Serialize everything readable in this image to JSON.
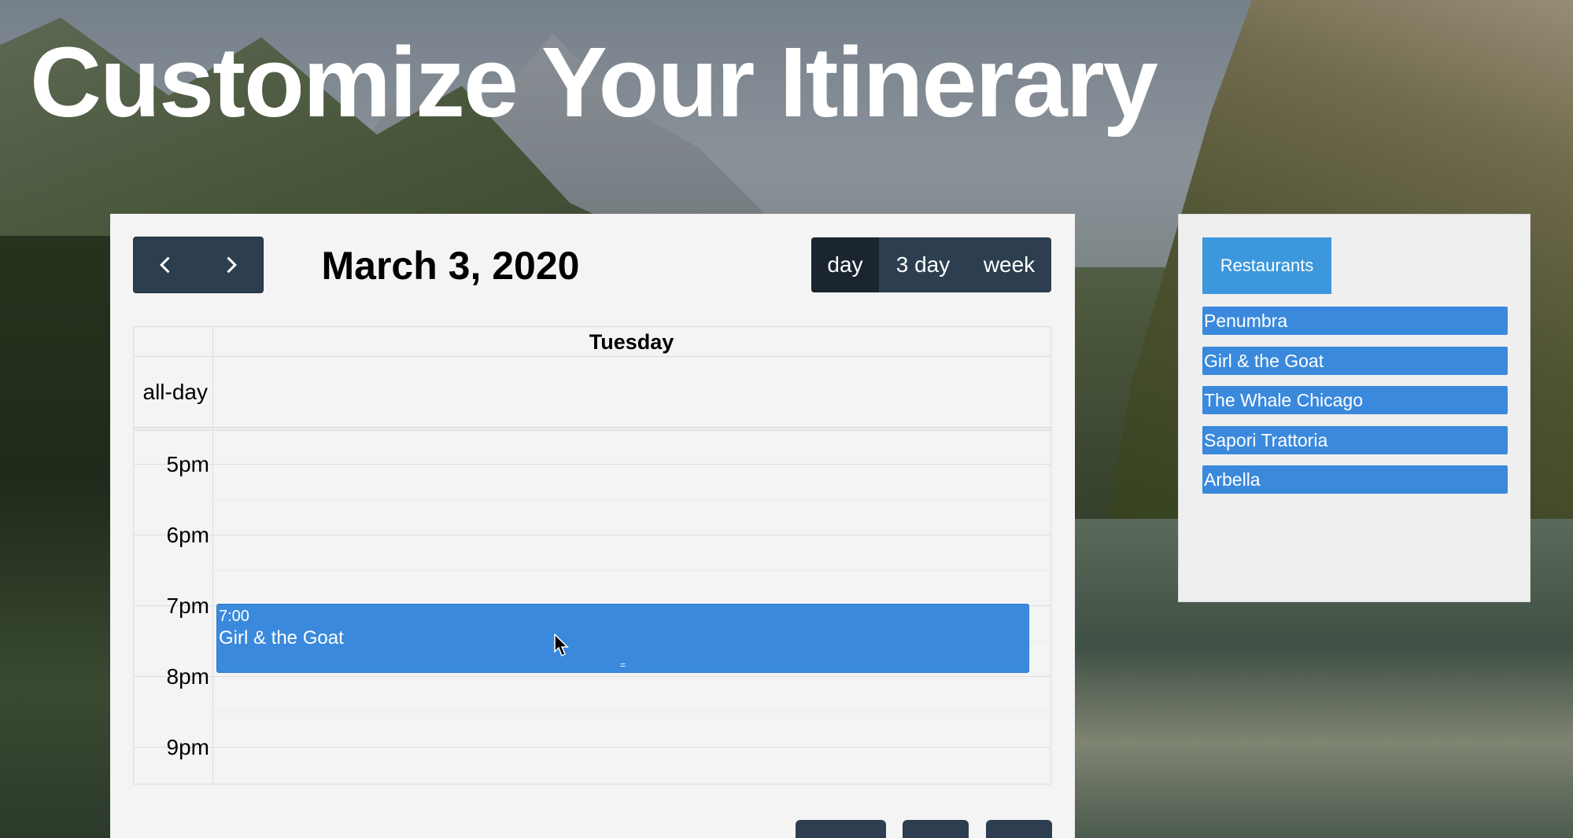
{
  "page": {
    "title": "Customize Your Itinerary"
  },
  "calendar": {
    "date_title": "March 3, 2020",
    "views": [
      "day",
      "3 day",
      "week"
    ],
    "active_view": "day",
    "day_header": "Tuesday",
    "allday_label": "all-day",
    "time_labels": [
      "5pm",
      "6pm",
      "7pm",
      "8pm",
      "9pm"
    ],
    "event": {
      "time": "7:00",
      "title": "Girl & the Goat",
      "resize_handle": "="
    }
  },
  "list": {
    "tab_label": "Restaurants",
    "items": [
      "Penumbra",
      "Girl & the Goat",
      "The Whale Chicago",
      "Sapori Trattoria",
      "Arbella"
    ]
  },
  "colors": {
    "nav": "#2c3e50",
    "nav_active": "#1a252f",
    "event": "#3a89dc",
    "tab": "#3d97dc",
    "panel": "#f4f4f4"
  }
}
